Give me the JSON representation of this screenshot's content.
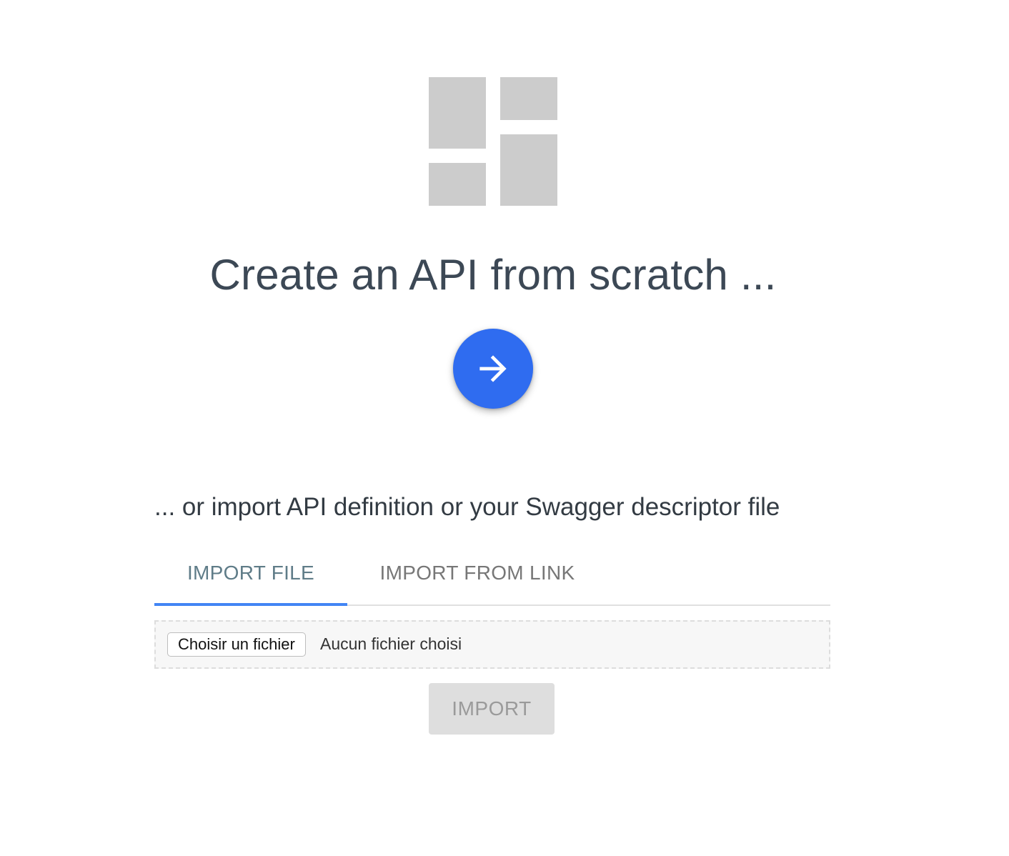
{
  "theme": {
    "accent": "#2f6cf0",
    "tab_indicator": "#4285f4",
    "logo_tile": "#cccccc"
  },
  "logo": {
    "icon": "dashboard-tiles-icon"
  },
  "create": {
    "heading": "Create an API from scratch ...",
    "button_icon": "arrow-right-icon"
  },
  "import": {
    "subheading": "... or import API definition or your Swagger descriptor file",
    "tabs": [
      {
        "label": "IMPORT FILE",
        "active": true
      },
      {
        "label": "IMPORT FROM LINK",
        "active": false
      }
    ],
    "file_button_label": "Choisir un fichier",
    "file_status": "Aucun fichier choisi",
    "import_button_label": "IMPORT",
    "import_button_disabled": true
  }
}
